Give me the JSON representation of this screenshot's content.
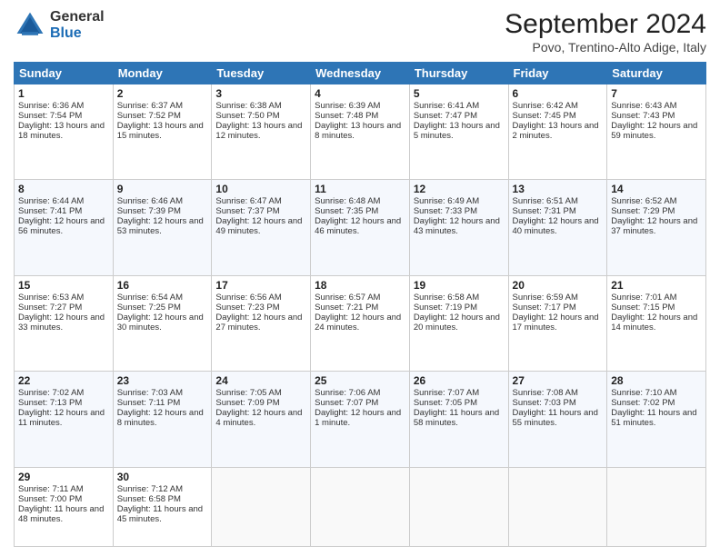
{
  "logo": {
    "general": "General",
    "blue": "Blue"
  },
  "header": {
    "month": "September 2024",
    "location": "Povo, Trentino-Alto Adige, Italy"
  },
  "weekdays": [
    "Sunday",
    "Monday",
    "Tuesday",
    "Wednesday",
    "Thursday",
    "Friday",
    "Saturday"
  ],
  "weeks": [
    [
      {
        "day": "1",
        "sunrise": "6:36 AM",
        "sunset": "7:54 PM",
        "daylight": "13 hours and 18 minutes."
      },
      {
        "day": "2",
        "sunrise": "6:37 AM",
        "sunset": "7:52 PM",
        "daylight": "13 hours and 15 minutes."
      },
      {
        "day": "3",
        "sunrise": "6:38 AM",
        "sunset": "7:50 PM",
        "daylight": "13 hours and 12 minutes."
      },
      {
        "day": "4",
        "sunrise": "6:39 AM",
        "sunset": "7:48 PM",
        "daylight": "13 hours and 8 minutes."
      },
      {
        "day": "5",
        "sunrise": "6:41 AM",
        "sunset": "7:47 PM",
        "daylight": "13 hours and 5 minutes."
      },
      {
        "day": "6",
        "sunrise": "6:42 AM",
        "sunset": "7:45 PM",
        "daylight": "13 hours and 2 minutes."
      },
      {
        "day": "7",
        "sunrise": "6:43 AM",
        "sunset": "7:43 PM",
        "daylight": "12 hours and 59 minutes."
      }
    ],
    [
      {
        "day": "8",
        "sunrise": "6:44 AM",
        "sunset": "7:41 PM",
        "daylight": "12 hours and 56 minutes."
      },
      {
        "day": "9",
        "sunrise": "6:46 AM",
        "sunset": "7:39 PM",
        "daylight": "12 hours and 53 minutes."
      },
      {
        "day": "10",
        "sunrise": "6:47 AM",
        "sunset": "7:37 PM",
        "daylight": "12 hours and 49 minutes."
      },
      {
        "day": "11",
        "sunrise": "6:48 AM",
        "sunset": "7:35 PM",
        "daylight": "12 hours and 46 minutes."
      },
      {
        "day": "12",
        "sunrise": "6:49 AM",
        "sunset": "7:33 PM",
        "daylight": "12 hours and 43 minutes."
      },
      {
        "day": "13",
        "sunrise": "6:51 AM",
        "sunset": "7:31 PM",
        "daylight": "12 hours and 40 minutes."
      },
      {
        "day": "14",
        "sunrise": "6:52 AM",
        "sunset": "7:29 PM",
        "daylight": "12 hours and 37 minutes."
      }
    ],
    [
      {
        "day": "15",
        "sunrise": "6:53 AM",
        "sunset": "7:27 PM",
        "daylight": "12 hours and 33 minutes."
      },
      {
        "day": "16",
        "sunrise": "6:54 AM",
        "sunset": "7:25 PM",
        "daylight": "12 hours and 30 minutes."
      },
      {
        "day": "17",
        "sunrise": "6:56 AM",
        "sunset": "7:23 PM",
        "daylight": "12 hours and 27 minutes."
      },
      {
        "day": "18",
        "sunrise": "6:57 AM",
        "sunset": "7:21 PM",
        "daylight": "12 hours and 24 minutes."
      },
      {
        "day": "19",
        "sunrise": "6:58 AM",
        "sunset": "7:19 PM",
        "daylight": "12 hours and 20 minutes."
      },
      {
        "day": "20",
        "sunrise": "6:59 AM",
        "sunset": "7:17 PM",
        "daylight": "12 hours and 17 minutes."
      },
      {
        "day": "21",
        "sunrise": "7:01 AM",
        "sunset": "7:15 PM",
        "daylight": "12 hours and 14 minutes."
      }
    ],
    [
      {
        "day": "22",
        "sunrise": "7:02 AM",
        "sunset": "7:13 PM",
        "daylight": "12 hours and 11 minutes."
      },
      {
        "day": "23",
        "sunrise": "7:03 AM",
        "sunset": "7:11 PM",
        "daylight": "12 hours and 8 minutes."
      },
      {
        "day": "24",
        "sunrise": "7:05 AM",
        "sunset": "7:09 PM",
        "daylight": "12 hours and 4 minutes."
      },
      {
        "day": "25",
        "sunrise": "7:06 AM",
        "sunset": "7:07 PM",
        "daylight": "12 hours and 1 minute."
      },
      {
        "day": "26",
        "sunrise": "7:07 AM",
        "sunset": "7:05 PM",
        "daylight": "11 hours and 58 minutes."
      },
      {
        "day": "27",
        "sunrise": "7:08 AM",
        "sunset": "7:03 PM",
        "daylight": "11 hours and 55 minutes."
      },
      {
        "day": "28",
        "sunrise": "7:10 AM",
        "sunset": "7:02 PM",
        "daylight": "11 hours and 51 minutes."
      }
    ],
    [
      {
        "day": "29",
        "sunrise": "7:11 AM",
        "sunset": "7:00 PM",
        "daylight": "11 hours and 48 minutes."
      },
      {
        "day": "30",
        "sunrise": "7:12 AM",
        "sunset": "6:58 PM",
        "daylight": "11 hours and 45 minutes."
      },
      null,
      null,
      null,
      null,
      null
    ]
  ]
}
